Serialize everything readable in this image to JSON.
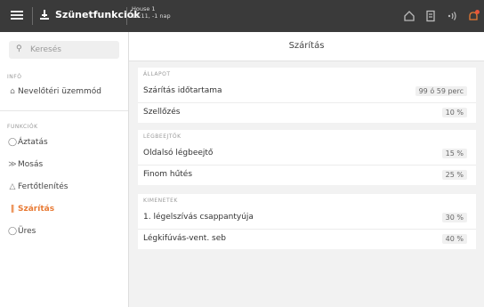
{
  "topbar": {
    "title": "Szünetfunkciók",
    "house_name": "House 1",
    "house_time": "13:11, -1 nap",
    "icons": [
      "home-icon",
      "document-icon",
      "wireless-icon",
      "bell-icon"
    ],
    "accent": "#e87a34"
  },
  "sidebar": {
    "search_placeholder": "Keresés",
    "section_info": "INFÓ",
    "info_items": [
      {
        "label": "Nevelőtéri üzemmód",
        "icon": "home-icon"
      }
    ],
    "section_functions": "FUNKCIÓK",
    "function_items": [
      {
        "label": "Áztatás",
        "icon": "drop-icon",
        "active": false
      },
      {
        "label": "Mosás",
        "icon": "wash-icon",
        "active": false
      },
      {
        "label": "Fertőtlenítés",
        "icon": "disinfect-icon",
        "active": false
      },
      {
        "label": "Szárítás",
        "icon": "dry-icon",
        "active": true
      },
      {
        "label": "Üres",
        "icon": "empty-icon",
        "active": false
      }
    ]
  },
  "main": {
    "title": "Szárítás",
    "groups": [
      {
        "header": "ÁLLAPOT",
        "rows": [
          {
            "label": "Szárítás időtartama",
            "value": "99 ó 59 perc"
          },
          {
            "label": "Szellőzés",
            "value": "10 %"
          }
        ]
      },
      {
        "header": "LÉGBEEJTŐK",
        "rows": [
          {
            "label": "Oldalsó légbeejtő",
            "value": "15 %"
          },
          {
            "label": "Finom hűtés",
            "value": "25 %"
          }
        ]
      },
      {
        "header": "KIMENETEK",
        "rows": [
          {
            "label": "1. légelszívás csappantyúja",
            "value": "30 %"
          },
          {
            "label": "Légkifúvás-vent. seb",
            "value": "40 %"
          }
        ]
      }
    ]
  }
}
